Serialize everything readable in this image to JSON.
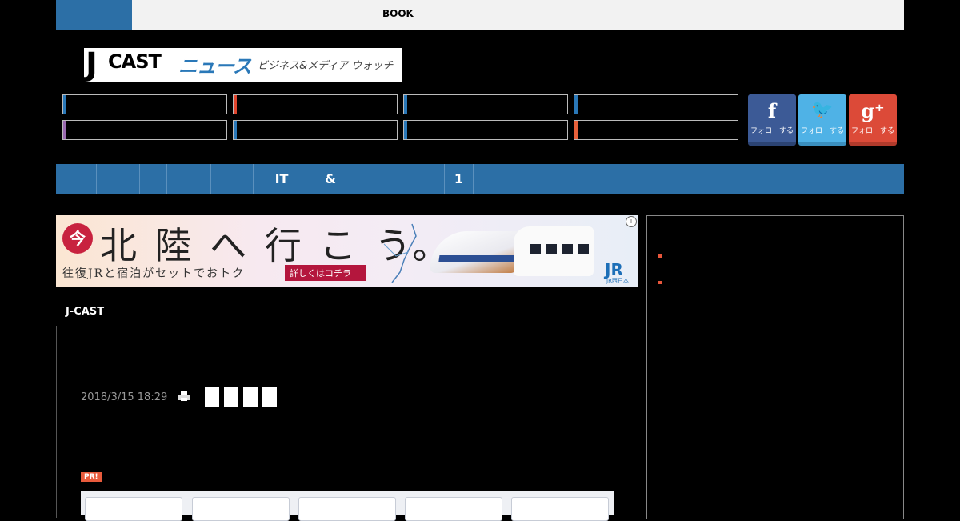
{
  "topbar": {
    "book_label": "BOOK"
  },
  "logo": {
    "j": "J",
    "cast": "CAST",
    "news": "ニュース",
    "tagline": "ビジネス&メディア ウォッチ"
  },
  "categories": [
    {
      "color": "#2a78b8"
    },
    {
      "color": "#e0452e"
    },
    {
      "color": "#2a78b8"
    },
    {
      "color": "#2a78b8"
    },
    {
      "color": "#9a6ab0"
    },
    {
      "color": "#2a78b8"
    },
    {
      "color": "#2a78b8"
    },
    {
      "color": "#e8603a"
    }
  ],
  "social": {
    "facebook": {
      "icon": "f",
      "label": "フォローする"
    },
    "twitter": {
      "icon": "🐦",
      "label": "フォローする"
    },
    "googleplus": {
      "icon": "g⁺",
      "label": "フォローする"
    }
  },
  "nav": {
    "items": [
      "",
      "",
      "",
      "",
      "",
      "IT",
      "&",
      "",
      "1"
    ]
  },
  "banner": {
    "badge": "今",
    "headline": "北 陸 へ 行 こ う。",
    "subline": "往復JRと宿泊がセットでおトク",
    "more": "詳しくはコチラ",
    "brand": "JR",
    "brand_sub": "JR西日本",
    "adinfo": "i"
  },
  "section": {
    "label": "J-CAST"
  },
  "article": {
    "date": "2018/3/15 18:29"
  },
  "pr": {
    "label": "PR!"
  }
}
